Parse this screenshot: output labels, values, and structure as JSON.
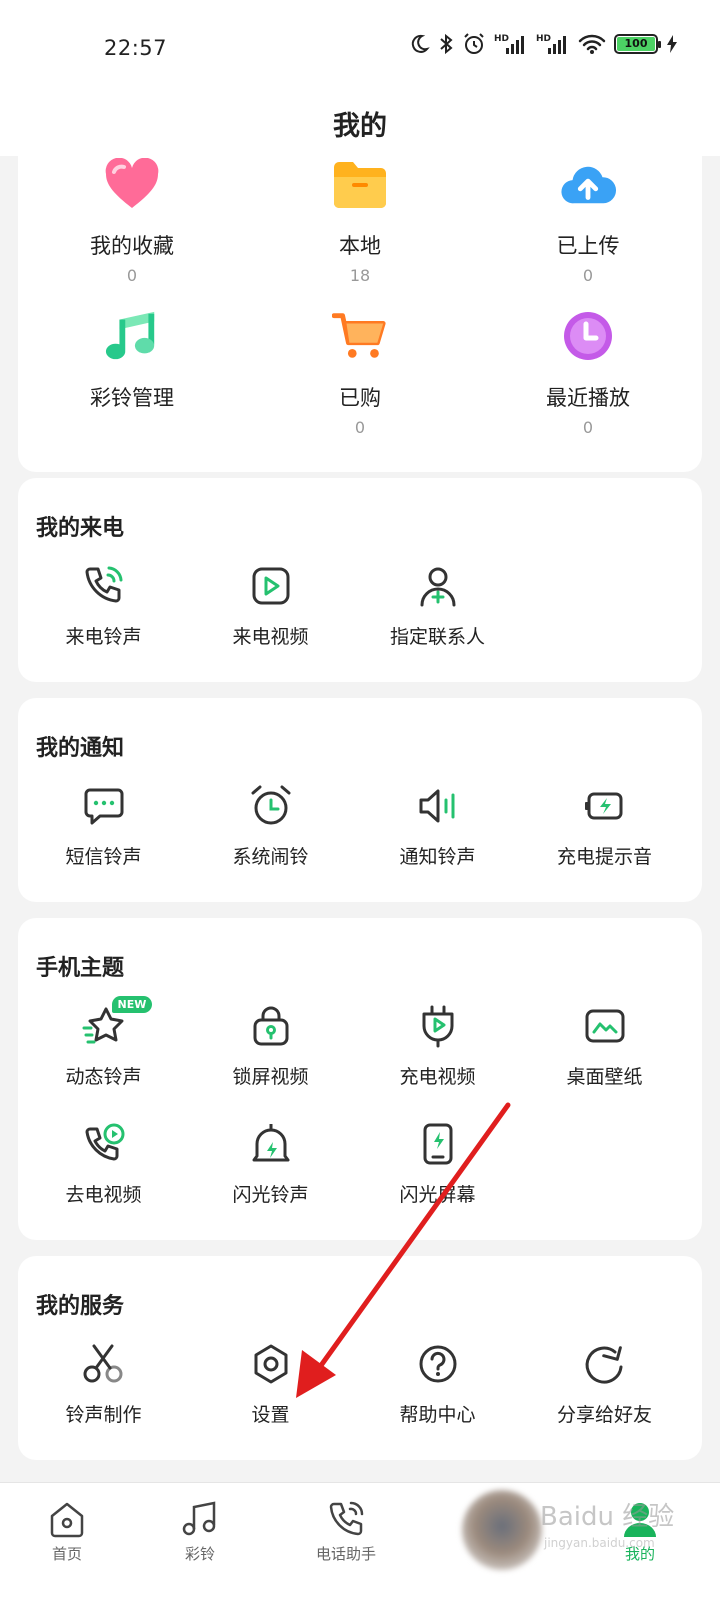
{
  "status": {
    "time": "22:57",
    "battery": "100",
    "hd1": "HD",
    "hd2": "HD"
  },
  "header": {
    "title": "我的"
  },
  "top_items": [
    {
      "label": "我的收藏",
      "count": "0",
      "icon": "heart-icon",
      "color": "#ff5a8a"
    },
    {
      "label": "本地",
      "count": "18",
      "icon": "folder-icon",
      "color": "#ffb728"
    },
    {
      "label": "已上传",
      "count": "0",
      "icon": "cloud-upload-icon",
      "color": "#3aa2f5"
    },
    {
      "label": "彩铃管理",
      "count": "",
      "icon": "music-note-icon",
      "color": "#27c98b"
    },
    {
      "label": "已购",
      "count": "0",
      "icon": "cart-icon",
      "color": "#ff7a22"
    },
    {
      "label": "最近播放",
      "count": "0",
      "icon": "clock-icon",
      "color": "#c45ae8"
    }
  ],
  "sections": {
    "incoming": {
      "title": "我的来电",
      "items": [
        "来电铃声",
        "来电视频",
        "指定联系人"
      ]
    },
    "notify": {
      "title": "我的通知",
      "items": [
        "短信铃声",
        "系统闹铃",
        "通知铃声",
        "充电提示音"
      ]
    },
    "theme": {
      "title": "手机主题",
      "items": [
        "动态铃声",
        "锁屏视频",
        "充电视频",
        "桌面壁纸",
        "去电视频",
        "闪光铃声",
        "闪光屏幕"
      ],
      "new_badge": "NEW"
    },
    "service": {
      "title": "我的服务",
      "items": [
        "铃声制作",
        "设置",
        "帮助中心",
        "分享给好友"
      ]
    }
  },
  "tabbar": [
    "首页",
    "彩铃",
    "电话助手",
    "我的"
  ],
  "watermark": "Baidu 经验",
  "watermark_url": "jingyan.baidu.com",
  "colors": {
    "accent": "#19b35b",
    "icon_dark": "#333333",
    "icon_green": "#25c16f",
    "arrow": "#e01e1e"
  }
}
